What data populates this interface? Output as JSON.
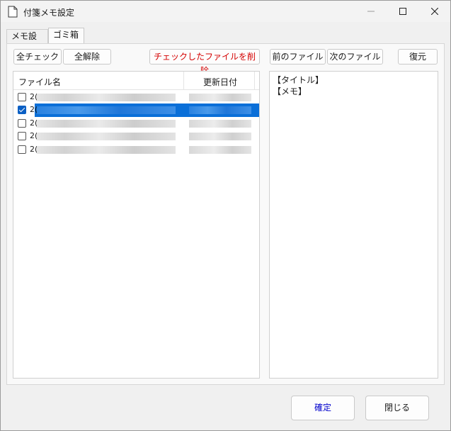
{
  "window": {
    "title": "付箋メモ設定",
    "icon": "document-icon"
  },
  "tabs": [
    {
      "label": "メモ設定",
      "active": false
    },
    {
      "label": "ゴミ箱",
      "active": true
    }
  ],
  "toolbar": {
    "check_all": "全チェック",
    "uncheck_all": "全解除",
    "delete_checked": "チェックしたファイルを削除",
    "prev_file": "前のファイル",
    "next_file": "次のファイル",
    "restore": "復元"
  },
  "file_list": {
    "columns": [
      "ファイル名",
      "更新日付"
    ],
    "rows": [
      {
        "name_prefix": "2(",
        "checked": false,
        "selected": false
      },
      {
        "name_prefix": "2(",
        "checked": true,
        "selected": true
      },
      {
        "name_prefix": "2(",
        "checked": false,
        "selected": false
      },
      {
        "name_prefix": "2(",
        "checked": false,
        "selected": false
      },
      {
        "name_prefix": "2(",
        "checked": false,
        "selected": false
      }
    ]
  },
  "memo_preview": {
    "title_label": "【タイトル】",
    "memo_label": "【メモ】"
  },
  "footer": {
    "ok": "確定",
    "close": "閉じる"
  },
  "colors": {
    "accent": "#0a6fd8",
    "delete_text": "#d40000",
    "ok_text": "#0000cc"
  }
}
